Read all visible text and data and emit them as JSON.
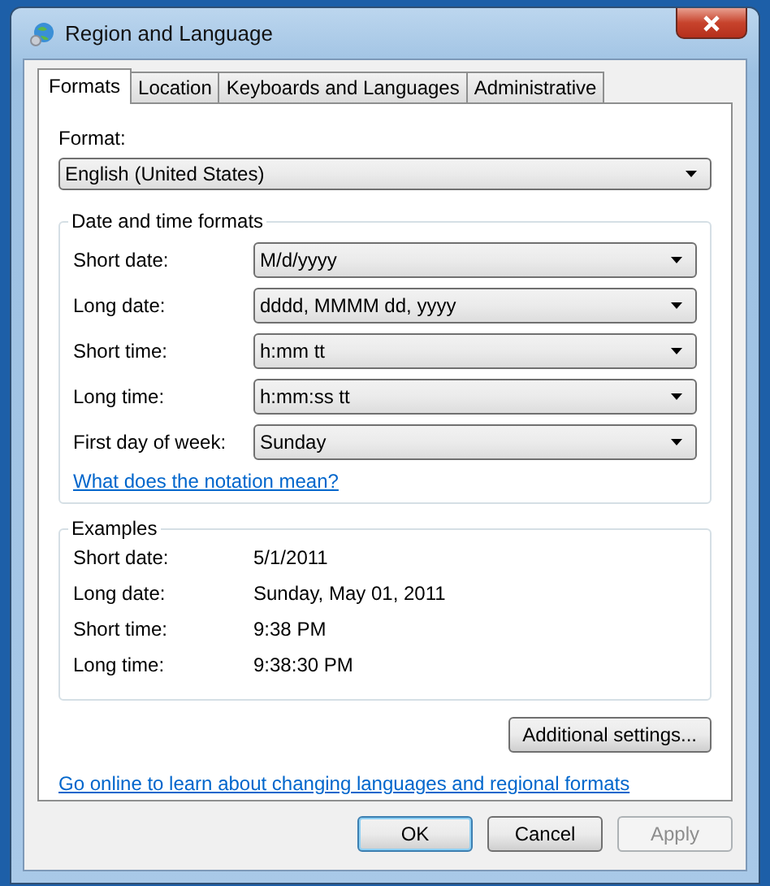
{
  "window": {
    "title": "Region and Language"
  },
  "tabs": [
    {
      "label": "Formats",
      "selected": true
    },
    {
      "label": "Location",
      "selected": false
    },
    {
      "label": "Keyboards and Languages",
      "selected": false
    },
    {
      "label": "Administrative",
      "selected": false
    }
  ],
  "format": {
    "label": "Format:",
    "value": "English (United States)"
  },
  "date_time_formats": {
    "title": "Date and time formats",
    "rows": [
      {
        "label": "Short date:",
        "value": "M/d/yyyy"
      },
      {
        "label": "Long date:",
        "value": "dddd, MMMM dd, yyyy"
      },
      {
        "label": "Short time:",
        "value": "h:mm tt"
      },
      {
        "label": "Long time:",
        "value": "h:mm:ss tt"
      },
      {
        "label": "First day of week:",
        "value": "Sunday"
      }
    ],
    "link": "What does the notation mean?"
  },
  "examples": {
    "title": "Examples",
    "rows": [
      {
        "label": "Short date:",
        "value": "5/1/2011"
      },
      {
        "label": "Long date:",
        "value": "Sunday, May 01, 2011"
      },
      {
        "label": "Short time:",
        "value": "9:38 PM"
      },
      {
        "label": "Long time:",
        "value": "9:38:30 PM"
      }
    ]
  },
  "additional_button": "Additional settings...",
  "online_link": "Go online to learn about changing languages and regional formats",
  "buttons": [
    {
      "label": "OK",
      "disabled": false,
      "focused": true
    },
    {
      "label": "Cancel",
      "disabled": false,
      "focused": false
    },
    {
      "label": "Apply",
      "disabled": true,
      "focused": false
    }
  ]
}
